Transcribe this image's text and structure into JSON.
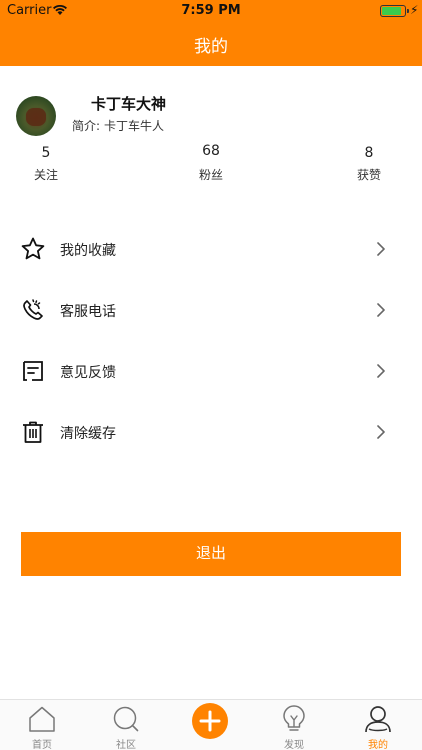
{
  "status_bar": {
    "carrier": "Carrier",
    "time": "7:59 PM",
    "battery_level": 0.85,
    "battery_color": "#3ACB4C"
  },
  "header": {
    "title": "我的",
    "background": "#FF8300"
  },
  "profile": {
    "username": "卡丁车大神",
    "bio_label": "简介:",
    "bio_text": "卡丁车牛人",
    "stats": [
      {
        "value": "5",
        "label": "关注"
      },
      {
        "value": "68",
        "label": "粉丝"
      },
      {
        "value": "8",
        "label": "获赞"
      }
    ]
  },
  "menu": [
    {
      "label": "我的收藏",
      "icon": "star-icon"
    },
    {
      "label": "客服电话",
      "icon": "phone-icon"
    },
    {
      "label": "意见反馈",
      "icon": "feedback-icon"
    },
    {
      "label": "清除缓存",
      "icon": "trash-icon"
    }
  ],
  "logout_label": "退出",
  "accent": "#FF8300",
  "tabbar": [
    {
      "label": "首页",
      "icon": "home-icon",
      "active": false
    },
    {
      "label": "社区",
      "icon": "search-icon",
      "active": false
    },
    {
      "label": "",
      "icon": "plus-icon",
      "active": false
    },
    {
      "label": "发现",
      "icon": "lightbulb-icon",
      "active": false
    },
    {
      "label": "我的",
      "icon": "person-icon",
      "active": true
    }
  ]
}
